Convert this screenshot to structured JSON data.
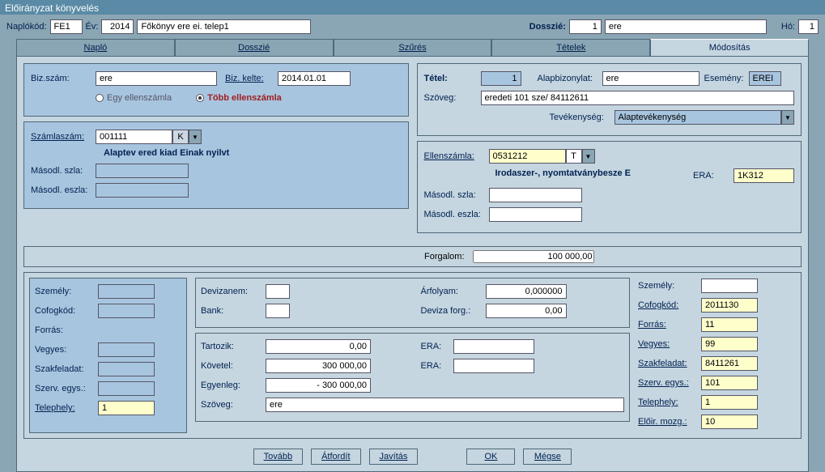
{
  "title": "Előirányzat könyvelés",
  "topbar": {
    "naplokod_lbl": "Naplókód:",
    "naplokod": "FE1",
    "ev_lbl": "Év:",
    "ev": "2014",
    "fokonyv": "Főkönyv ere ei. telep1",
    "dosszie_lbl": "Dosszié:",
    "dosszie_n": "1",
    "dosszie_t": "ere",
    "ho_lbl": "Hó:",
    "ho": "1"
  },
  "tabs": {
    "t1": "Napló",
    "t2": "Dosszié",
    "t3": "Szűrés",
    "t4": "Tételek",
    "t5": "Módosítás"
  },
  "left": {
    "bizszam_lbl": "Biz.szám:",
    "bizszam": "ere",
    "bizkelte_lbl": "Biz. kelte:",
    "bizkelte": "2014.01.01",
    "radio_egy": "Egy ellenszámla",
    "radio_tobb": "Több ellenszámla",
    "szamlaszam_lbl": "Számlaszám:",
    "szamlaszam": "001111",
    "szamlaszam_ind": "K",
    "szamlaszam_desc": "Alaptev ered kiad Einak nyilvt",
    "masodl_szla_lbl": "Másodl. szla:",
    "masodl_eszla_lbl": "Másodl. eszla:"
  },
  "right": {
    "tetel_lbl": "Tétel:",
    "tetel": "1",
    "alapbiz_lbl": "Alapbizonylat:",
    "alapbiz": "ere",
    "esemeny_lbl": "Esemény:",
    "esemeny": "EREI",
    "szoveg_lbl": "Szöveg:",
    "szoveg": "eredeti 101 sze/ 84112611",
    "tevekenyseg_lbl": "Tevékenység:",
    "tevekenyseg": "Alaptevékenység",
    "ellenszamla_lbl": "Ellenszámla:",
    "ellenszamla": "0531212",
    "ellenszamla_ind": "T",
    "ellenszamla_desc": "Irodaszer-, nyomtatványbesze E",
    "era_lbl": "ERA:",
    "era": "1K312",
    "masodl_szla_lbl": "Másodl. szla:",
    "masodl_eszla_lbl": "Másodl. eszla:"
  },
  "forgalom_lbl": "Forgalom:",
  "forgalom": "100 000,00",
  "leftn": {
    "szemely_lbl": "Személy:",
    "cofogkod_lbl": "Cofogkód:",
    "forras_lbl": "Forrás:",
    "vegyes_lbl": "Vegyes:",
    "szakfeladat_lbl": "Szakfeladat:",
    "szervegys_lbl": "Szerv. egys.:",
    "telephely_lbl": "Telephely:",
    "telephely": "1"
  },
  "mid1": {
    "devizanem_lbl": "Devizanem:",
    "bank_lbl": "Bank:",
    "arfolyam_lbl": "Árfolyam:",
    "arfolyam": "0,000000",
    "devizaforg_lbl": "Deviza forg.:",
    "devizaforg": "0,00"
  },
  "mid2": {
    "tartozik_lbl": "Tartozik:",
    "tartozik": "0,00",
    "kovetel_lbl": "Követel:",
    "kovetel": "300 000,00",
    "egyenleg_lbl": "Egyenleg:",
    "egyenleg": "- 300 000,00",
    "era_lbl": "ERA:",
    "szoveg_lbl": "Szöveg:",
    "szoveg": "ere"
  },
  "rightn": {
    "szemely_lbl": "Személy:",
    "cofogkod_lbl": "Cofogkód:",
    "cofogkod": "2011130",
    "forras_lbl": "Forrás:",
    "forras": "11",
    "vegyes_lbl": "Vegyes:",
    "vegyes": "99",
    "szakfeladat_lbl": "Szakfeladat:",
    "szakfeladat": "8411261",
    "szervegys_lbl": "Szerv. egys.:",
    "szervegys": "101",
    "telephely_lbl": "Telephely:",
    "telephely": "1",
    "eloir_lbl": "Előir. mozg.:",
    "eloir": "10"
  },
  "btns": {
    "tovabb": "Tovább",
    "atfordit": "Átfordít",
    "javitas": "Javítás",
    "ok": "OK",
    "megse": "Mégse"
  }
}
